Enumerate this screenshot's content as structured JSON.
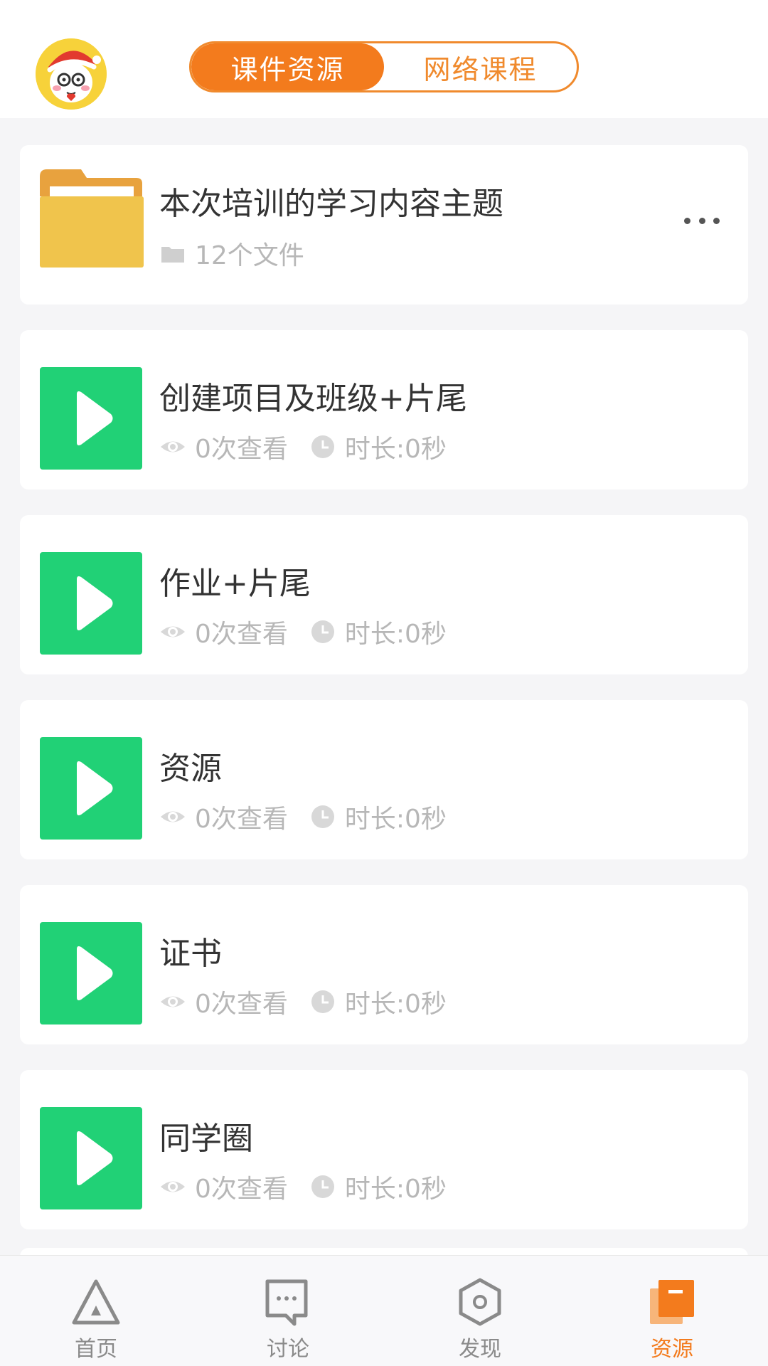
{
  "header": {
    "avatar_alt": "avatar",
    "tabs": [
      {
        "label": "课件资源",
        "active": true
      },
      {
        "label": "网络课程",
        "active": false
      }
    ]
  },
  "folder": {
    "title": "本次培训的学习内容主题",
    "file_count": "12个文件"
  },
  "videos": [
    {
      "title": "创建项目及班级+片尾",
      "views": "0次查看",
      "duration": "时长:0秒"
    },
    {
      "title": "作业+片尾",
      "views": "0次查看",
      "duration": "时长:0秒"
    },
    {
      "title": "资源",
      "views": "0次查看",
      "duration": "时长:0秒"
    },
    {
      "title": "证书",
      "views": "0次查看",
      "duration": "时长:0秒"
    },
    {
      "title": "同学圈",
      "views": "0次查看",
      "duration": "时长:0秒"
    }
  ],
  "nav": {
    "items": [
      {
        "label": "首页",
        "icon": "triangle-home-icon",
        "active": false
      },
      {
        "label": "讨论",
        "icon": "chat-icon",
        "active": false
      },
      {
        "label": "发现",
        "icon": "hexagon-discover-icon",
        "active": false
      },
      {
        "label": "资源",
        "icon": "resource-icon",
        "active": true
      }
    ]
  },
  "colors": {
    "accent": "#f37b1d",
    "video_thumb": "#21d176",
    "folder": "#f0c44c"
  }
}
